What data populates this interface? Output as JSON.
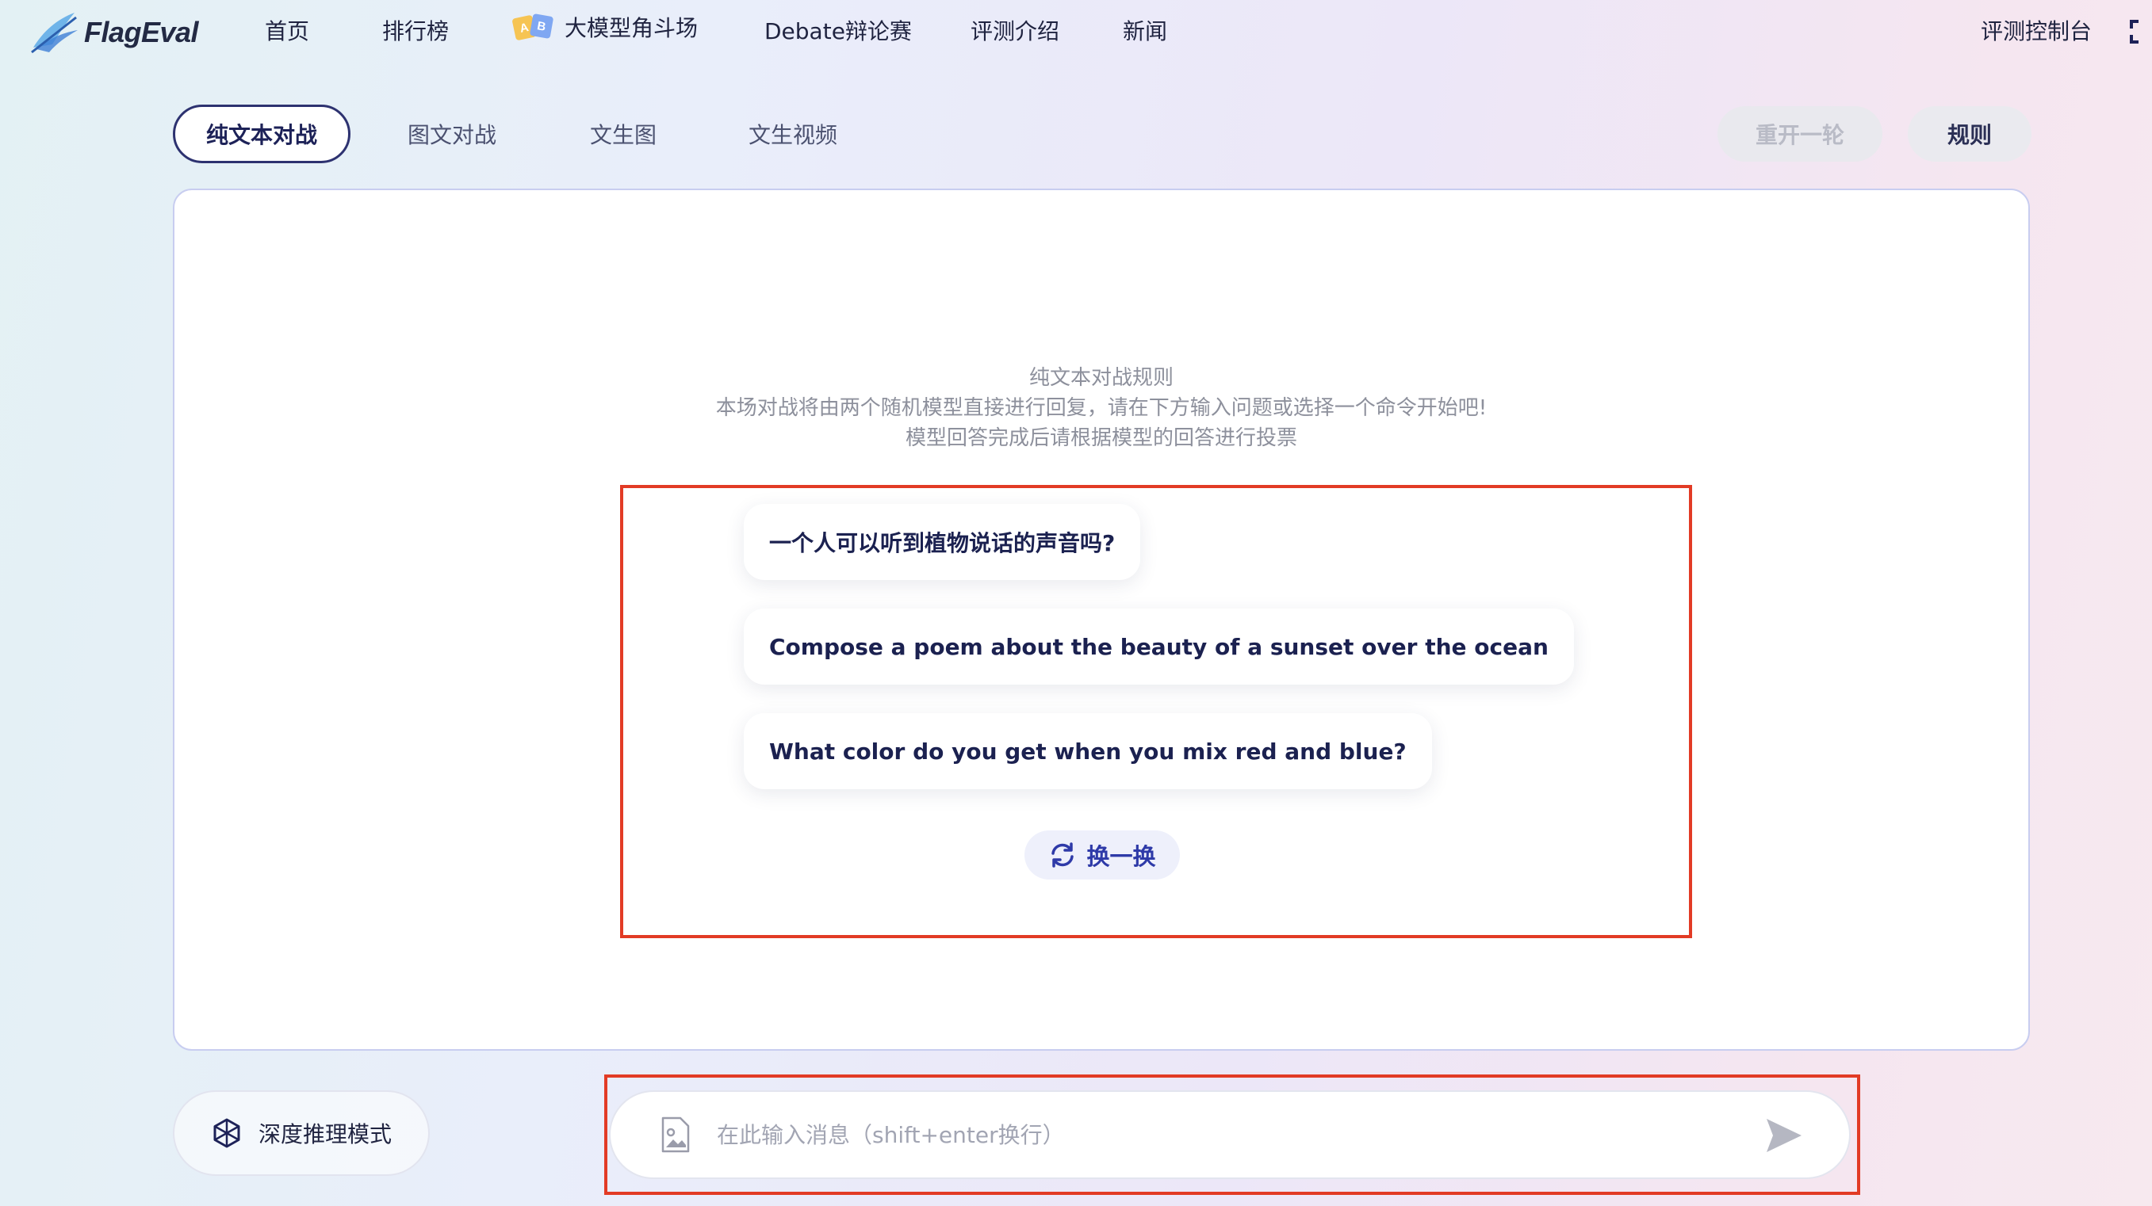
{
  "brand": {
    "name": "FlagEval"
  },
  "nav": {
    "home": "首页",
    "leaderboard": "排行榜",
    "arena": "大模型角斗场",
    "arena_icon_letters": [
      "A",
      "B"
    ],
    "debate": "Debate辩论赛",
    "intro": "评测介绍",
    "news": "新闻",
    "console": "评测控制台"
  },
  "tabs": [
    {
      "label": "纯文本对战",
      "active": true
    },
    {
      "label": "图文对战",
      "active": false
    },
    {
      "label": "文生图",
      "active": false
    },
    {
      "label": "文生视频",
      "active": false
    }
  ],
  "actions": {
    "restart": "重开一轮",
    "rules": "规则"
  },
  "rules": {
    "title": "纯文本对战规则",
    "line1": "本场对战将由两个随机模型直接进行回复，请在下方输入问题或选择一个命令开始吧!",
    "line2": "模型回答完成后请根据模型的回答进行投票"
  },
  "suggestions": [
    "一个人可以听到植物说话的声音吗?",
    "Compose a poem about the beauty of a sunset over the ocean",
    "What color do you get when you mix red and blue?"
  ],
  "shuffle_label": "换一换",
  "deep_reasoning": "深度推理模式",
  "composer": {
    "placeholder": "在此输入消息（shift+enter换行）",
    "value": ""
  },
  "icons": [
    "flageval-logo",
    "ab-flags-icon",
    "fullscreen-icon",
    "refresh-icon",
    "reasoning-cube-icon",
    "image-upload-icon",
    "send-icon"
  ],
  "colors": {
    "accent": "#2d3270",
    "highlight": "#e23b25",
    "shuffle_text": "#2e3aa8"
  }
}
